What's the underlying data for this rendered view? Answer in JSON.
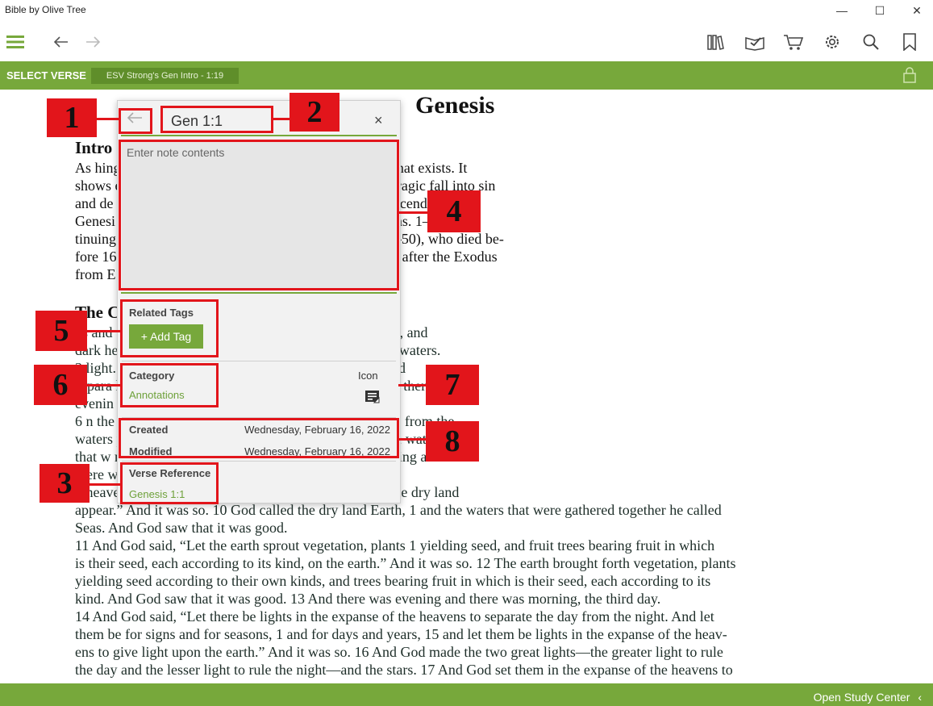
{
  "window": {
    "title": "Bible by Olive Tree",
    "minimize": "—",
    "maximize": "☐",
    "close": "✕"
  },
  "toolbar": {
    "menu_icon": "hamburger-icon",
    "back_icon": "back-arrow-icon",
    "forward_icon": "forward-arrow-icon",
    "right_icons": [
      "library-icon",
      "reading-plan-icon",
      "store-cart-icon",
      "settings-gear-icon",
      "search-icon",
      "bookmark-icon"
    ]
  },
  "bar": {
    "select_verse": "SELECT VERSE",
    "current_verse": "ESV Strong's Gen Intro - 1:19",
    "lock_icon": "lock-icon"
  },
  "reader": {
    "book_title": "Genesis",
    "heading_intro": "Intro",
    "heading_creation": "The C",
    "intro_lines": [
      "    As                                           hings. Genesis tells us that God created everything that exists. It",
      "shows                                            er of all creation. But it also tells of humanity’s tragic fall into sin",
      "and de                                           mptio               gh his covenant with Abraham and his descendants.",
      "Genesi                                           storie               e Bible, beginning with Adam and Eve (chs. 1–4), con-",
      "tinuing                                          cob, and ending with the life of Joseph (chs. 37–50), who died be-",
      "fore 16                                          as have recognized Moses as the author, writing after the Exodus",
      "from E                                           though some prefer a date around 1260 B.C."
    ],
    "verse_lines": [
      "                                                 ns and the earth. 2 The earth was  without form and void, and",
      "dark                                             he Spirit of God was hovering over the face of the waters.",
      "    3                                                              light. 4 And God saw that the light was good. And God",
      "separa                                                        lled         t Day, and the darkness he called Night. And there was",
      "evenin",
      "    6                                            n the midst of the waters, and let it separate the waters from the",
      "waters                                           para            waters that were under the expanse from the waters",
      "that w                                           nd            ed the expanse Heaven. 1 And there was evening and",
      "there w",
      "    9                                            heavens be gathered together into one place, and let the dry land",
      "appear.” And it was so. 10 God called the dry land Earth, 1 and the waters that were gathered together he called",
      "Seas. And God saw that it was good.",
      "    11 And God said,  “Let the earth sprout vegetation, plants 1 yielding seed, and fruit trees bearing fruit in which",
      "is their seed, each according to its kind, on the earth.” And it was so. 12 The earth brought forth vegetation, plants",
      "yielding seed according to their own kinds, and trees bearing fruit in which is their seed, each according to its",
      "kind. And God saw that it was good. 13 And there was evening and there was morning, the third day.",
      "    14 And God said, “Let there be lights in the expanse of the heavens to separate the day from the night. And let",
      "them be for  signs and for  seasons, 1 and for days and years, 15 and let them be lights in the expanse of the heav-",
      "ens to give light upon the earth.” And it was so. 16 And God  made the two great lights—the greater light to rule",
      "the day and the lesser light to rule the night—and the stars. 17 And God set them in the expanse of the heavens to"
    ]
  },
  "note": {
    "back_icon": "back-arrow-icon",
    "reference_value": "Gen 1:1",
    "close_label": "×",
    "content_placeholder": "Enter note contents",
    "related_tags_label": "Related Tags",
    "add_tag_label": "+  Add Tag",
    "category_label": "Category",
    "category_value": "Annotations",
    "icon_label": "Icon",
    "note_icon": "note-icon",
    "created_label": "Created",
    "created_value": "Wednesday, February 16, 2022",
    "modified_label": "Modified",
    "modified_value": "Wednesday, February 16, 2022",
    "verse_reference_label": "Verse Reference",
    "verse_reference_value": "Genesis 1:1"
  },
  "callouts": [
    "1",
    "2",
    "3",
    "4",
    "5",
    "6",
    "7",
    "8"
  ],
  "footer": {
    "open_study_center": "Open Study Center",
    "chevron_icon": "chevron-left-icon"
  },
  "colors": {
    "accent": "#77a83b",
    "callout": "#e2151b",
    "word_link": "#2c5f4c"
  }
}
